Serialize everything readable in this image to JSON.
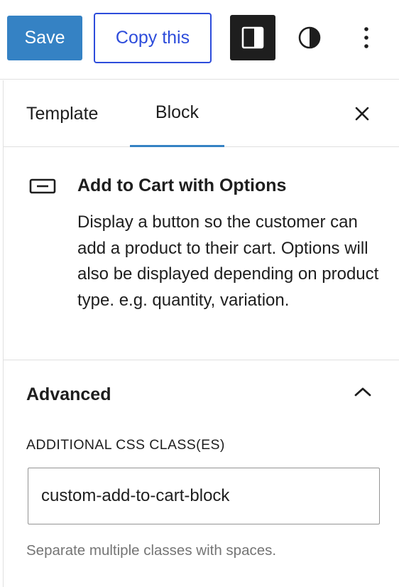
{
  "toolbar": {
    "save_label": "Save",
    "copy_label": "Copy this",
    "sidebar_icon": "sidebar-toggle-icon",
    "styles_icon": "half-circle-contrast-icon",
    "more_icon": "vertical-ellipsis-icon"
  },
  "tabs": [
    {
      "label": "Template",
      "active": false
    },
    {
      "label": "Block",
      "active": true
    }
  ],
  "close_icon": "close-icon",
  "block": {
    "icon": "button-outline-icon",
    "title": "Add to Cart with Options",
    "description": "Display a button so the customer can add a product to their cart. Options will also be displayed depending on product type. e.g. quantity, variation."
  },
  "advanced": {
    "title": "Advanced",
    "expanded": true,
    "css_label": "ADDITIONAL CSS CLASS(ES)",
    "css_value": "custom-add-to-cart-block",
    "css_help": "Separate multiple classes with spaces."
  },
  "colors": {
    "primary": "#3582c4",
    "copy_border": "#2d4cdb",
    "dark_button": "#1e1e1e",
    "border": "#e0e0e0",
    "help_text": "#757575"
  }
}
